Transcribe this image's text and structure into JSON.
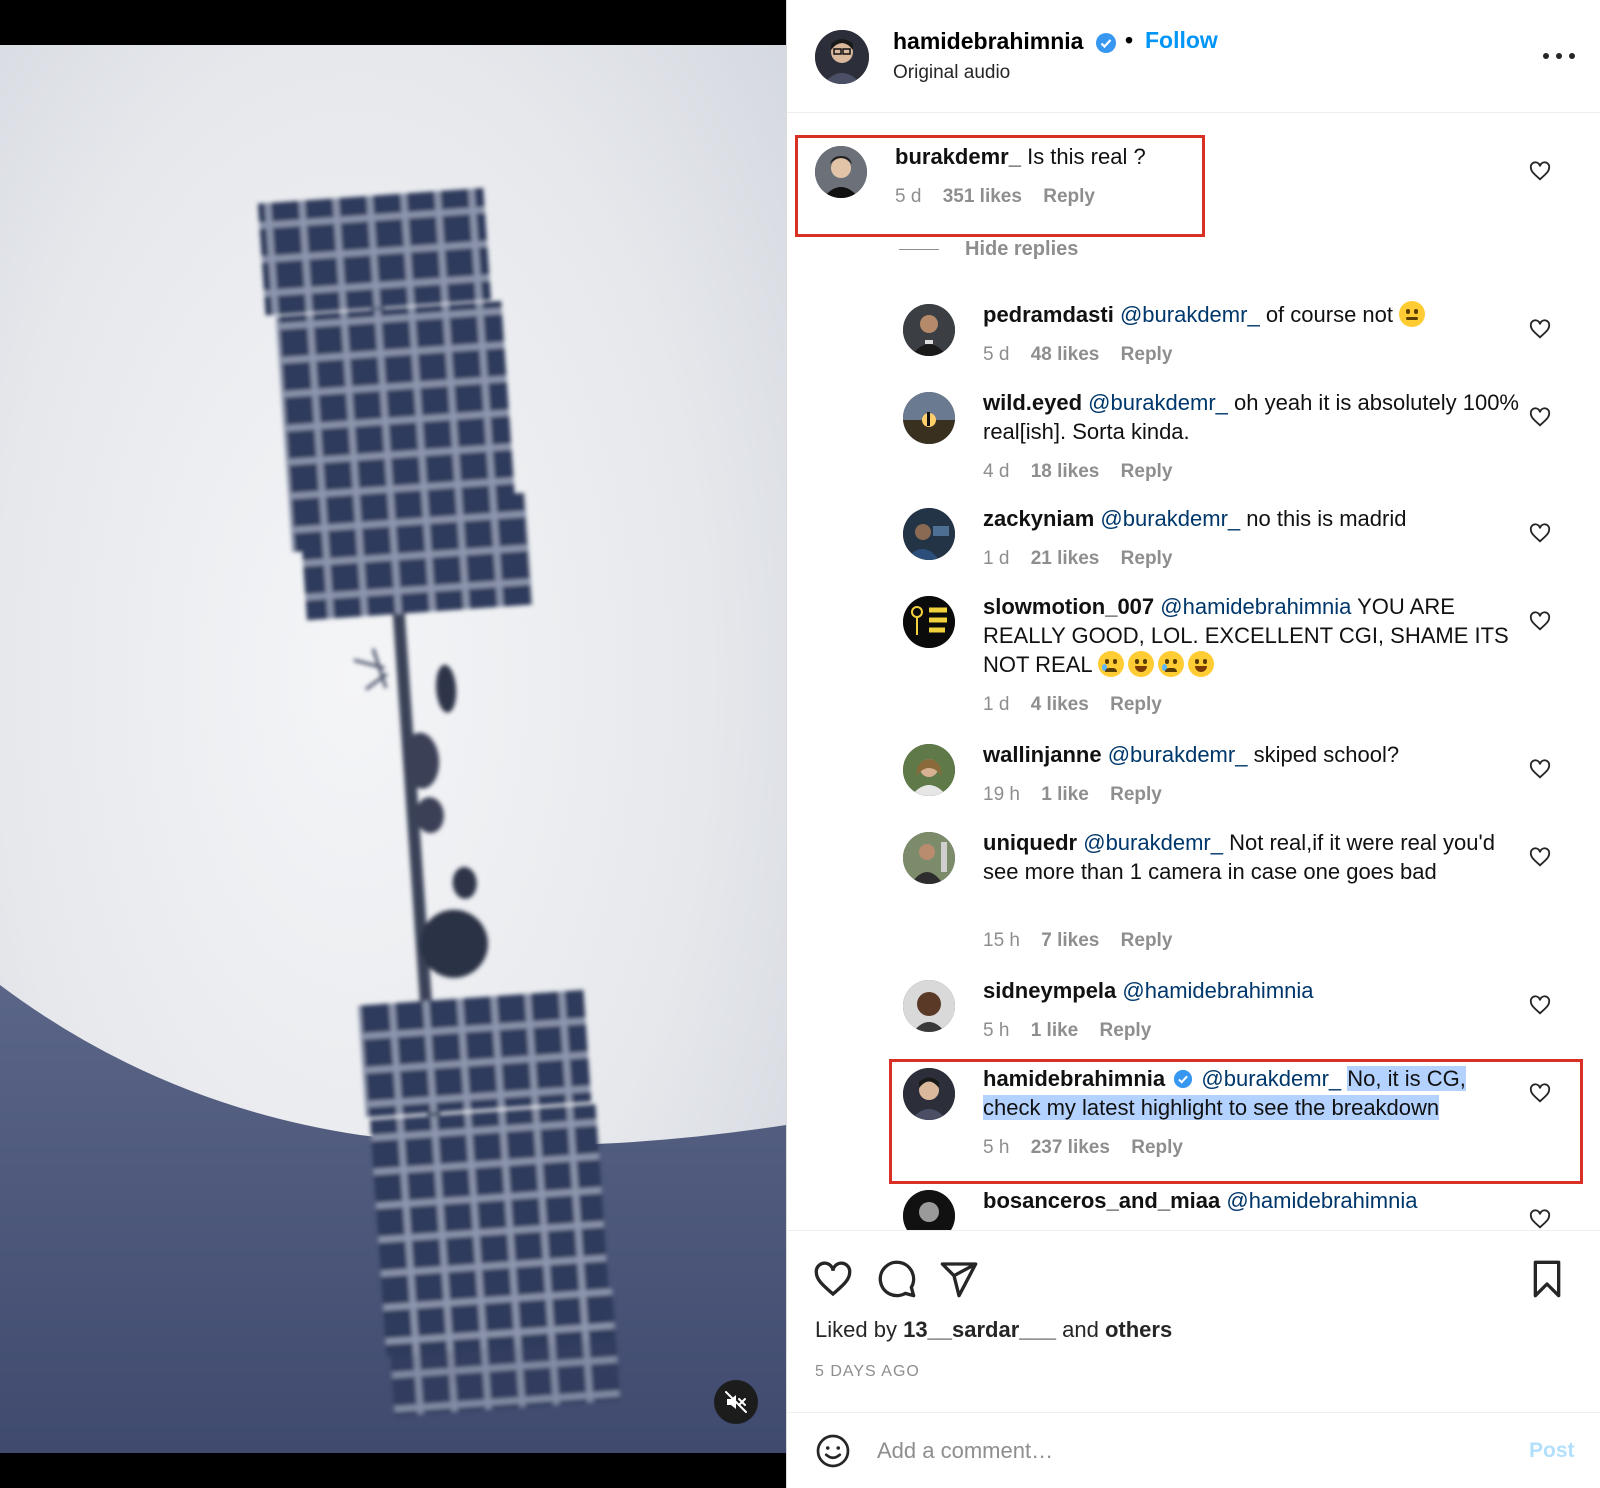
{
  "post": {
    "author": "hamidebrahimnia",
    "separator": "•",
    "follow_label": "Follow",
    "audio": "Original audio"
  },
  "comments": {
    "top": {
      "user": "burakdemr_",
      "text": "Is this real ?",
      "time": "5 d",
      "likes": "351 likes",
      "reply": "Reply"
    },
    "hide_replies": "Hide replies",
    "replies": [
      {
        "user": "pedramdasti",
        "mention": "@burakdemr_",
        "text": "of course not",
        "time": "5 d",
        "likes": "48 likes",
        "reply": "Reply"
      },
      {
        "user": "wild.eyed",
        "mention": "@burakdemr_",
        "text": "oh yeah it is absolutely 100% real[ish]. Sorta kinda.",
        "time": "4 d",
        "likes": "18 likes",
        "reply": "Reply"
      },
      {
        "user": "zackyniam",
        "mention": "@burakdemr_",
        "text": "no this is madrid",
        "time": "1 d",
        "likes": "21 likes",
        "reply": "Reply"
      },
      {
        "user": "slowmotion_007",
        "mention": "@hamidebrahimnia",
        "text": "YOU ARE REALLY GOOD, LOL. EXCELLENT CGI, SHAME ITS NOT REAL",
        "time": "1 d",
        "likes": "4 likes",
        "reply": "Reply"
      },
      {
        "user": "wallinjanne",
        "mention": "@burakdemr_",
        "text": "skiped school?",
        "time": "19 h",
        "likes": "1 like",
        "reply": "Reply"
      },
      {
        "user": "uniquedr",
        "mention": "@burakdemr_",
        "text": "Not real,if it were real you'd see more than 1 camera in case one goes bad",
        "time": "15 h",
        "likes": "7 likes",
        "reply": "Reply"
      },
      {
        "user": "sidneympela",
        "mention": "@hamidebrahimnia",
        "text": "",
        "time": "5 h",
        "likes": "1 like",
        "reply": "Reply"
      },
      {
        "user": "hamidebrahimnia",
        "mention": "@burakdemr_",
        "text": "No, it is CG, check my latest highlight to see the breakdown",
        "time": "5 h",
        "likes": "237 likes",
        "reply": "Reply"
      },
      {
        "user": "bosanceros_and_miaa",
        "mention": "@hamidebrahimnia",
        "text": "",
        "time": "",
        "likes": "",
        "reply": ""
      }
    ]
  },
  "actions": {
    "liked_prefix": "Liked by",
    "liked_user": "13__sardar___",
    "liked_and": "and",
    "liked_others": "others",
    "date": "5 DAYS AGO"
  },
  "composer": {
    "placeholder": "Add a comment…",
    "post_label": "Post"
  },
  "colors": {
    "link_blue": "#0095f6",
    "mention_blue": "#00376b",
    "highlight_box": "#d93025",
    "selection": "#b4d2ff"
  },
  "icons": [
    "verified-badge-icon",
    "more-options-icon",
    "heart-icon",
    "comment-icon",
    "share-icon",
    "bookmark-icon",
    "emoji-icon",
    "mute-icon"
  ]
}
